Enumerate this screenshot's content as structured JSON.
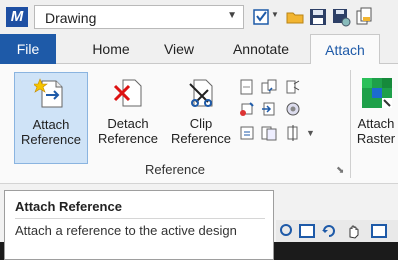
{
  "app": {
    "logo_letter": "M"
  },
  "workspace": {
    "selected": "Drawing"
  },
  "quick_access": [
    "workflow-icon",
    "open-folder-icon",
    "save-icon",
    "save-settings-icon",
    "copy-icon"
  ],
  "tabs": [
    {
      "label": "File",
      "active": false
    },
    {
      "label": "Home",
      "active": false
    },
    {
      "label": "View",
      "active": false
    },
    {
      "label": "Annotate",
      "active": false
    },
    {
      "label": "Attach",
      "active": true
    }
  ],
  "ribbon": {
    "group_label": "Reference",
    "buttons": {
      "attach_reference": {
        "line1": "Attach",
        "line2": "Reference"
      },
      "detach_reference": {
        "line1": "Detach",
        "line2": "Reference"
      },
      "clip_reference": {
        "line1": "Clip",
        "line2": "Reference"
      },
      "attach_raster": {
        "line1": "Attach",
        "line2": "Raster"
      }
    }
  },
  "tooltip": {
    "title": "Attach Reference",
    "body": "Attach a reference to the active design"
  },
  "colors": {
    "accent": "#1e5aa8",
    "selected_bg": "#cfe3f7"
  }
}
